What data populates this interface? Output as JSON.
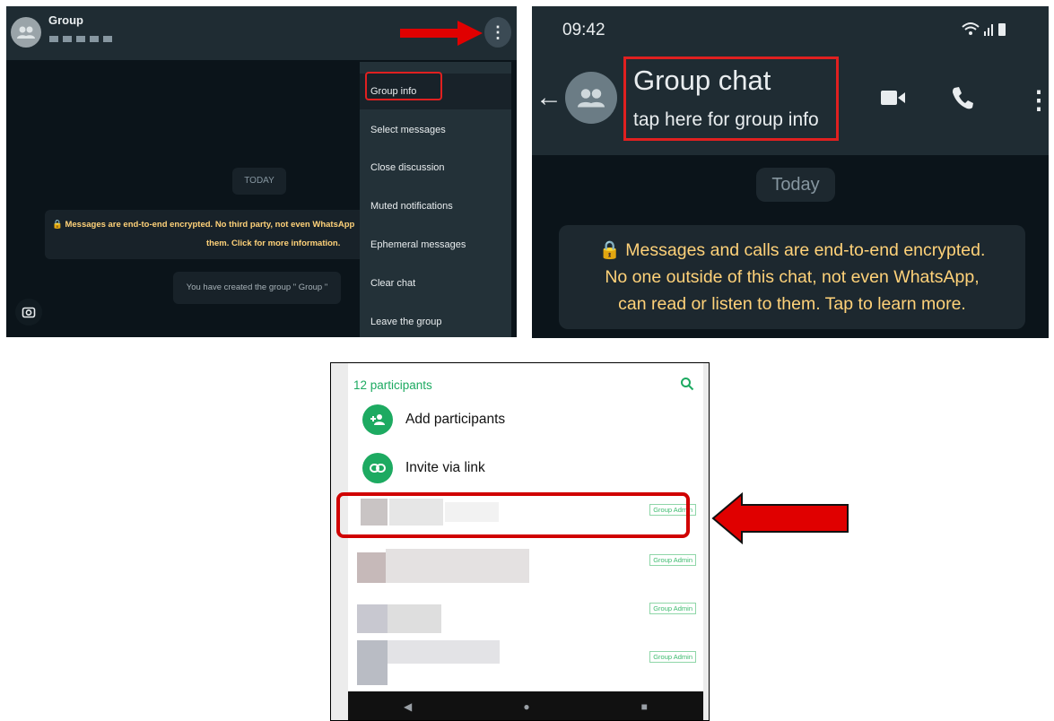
{
  "desktop": {
    "header": {
      "title": "Group"
    },
    "menu": {
      "items": [
        "Group info",
        "Select messages",
        "Close discussion",
        "Muted notifications",
        "Ephemeral messages",
        "Clear chat",
        "Leave the group"
      ]
    },
    "chat": {
      "date_pill": "TODAY",
      "encryption_line1": "🔒 Messages are end-to-end encrypted. No third party, not even WhatsApp",
      "encryption_line2": "them. Click for more information.",
      "created_notice": "You have created the group \" Group \""
    },
    "colors": {
      "highlight": "#e02020",
      "header": "#1f2c33",
      "background": "#0b141a"
    }
  },
  "phone_chat": {
    "status_bar": {
      "time": "09:42"
    },
    "header": {
      "title": "Group chat",
      "subtitle": "tap here for group info"
    },
    "date_pill": "Today",
    "encryption_notice": [
      "🔒 Messages and calls are end-to-end encrypted.",
      "No one outside of this chat, not even WhatsApp,",
      "can read or listen to them. Tap to learn more."
    ]
  },
  "participants": {
    "count_label": "12 participants",
    "actions": [
      {
        "label": "Add participants",
        "icon": "add-person-icon"
      },
      {
        "label": "Invite via link",
        "icon": "link-icon"
      }
    ],
    "admin_badge": "Group Admin",
    "accent": "#1daa61"
  }
}
